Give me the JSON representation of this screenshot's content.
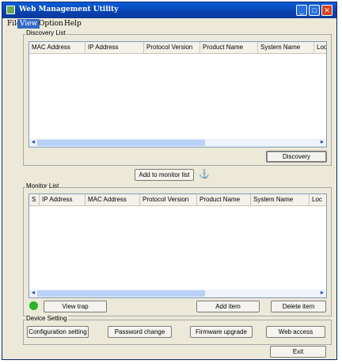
{
  "window": {
    "title": "Web Management Utility",
    "controls": {
      "minimize": "_",
      "maximize": "□",
      "close": "✕"
    }
  },
  "menu": [
    "File",
    "View",
    "Option",
    "Help"
  ],
  "discovery": {
    "legend": "Discovery List",
    "columns": [
      "MAC Address",
      "IP Address",
      "Protocol Version",
      "Product Name",
      "System Name",
      "Loc"
    ],
    "discover_button": "Discovery"
  },
  "add_to_monitor_button": "Add to monitor list",
  "anchor_icon_glyph": "⚓",
  "monitor": {
    "legend": "Monitor List",
    "columns": [
      "S",
      "IP Address",
      "MAC Address",
      "Protocol Version",
      "Product Name",
      "System Name",
      "Loc"
    ],
    "view_trap_button": "View trap",
    "add_item_button": "Add item",
    "delete_item_button": "Delete item",
    "status_color": "#2bb32b"
  },
  "device_setting": {
    "legend": "Device Setting",
    "config_button": "Configuration setting",
    "password_button": "Password change",
    "firmware_button": "Firmware upgrade",
    "web_button": "Web access"
  },
  "exit_button": "Exit",
  "scroll": {
    "left": "◄",
    "right": "►"
  }
}
